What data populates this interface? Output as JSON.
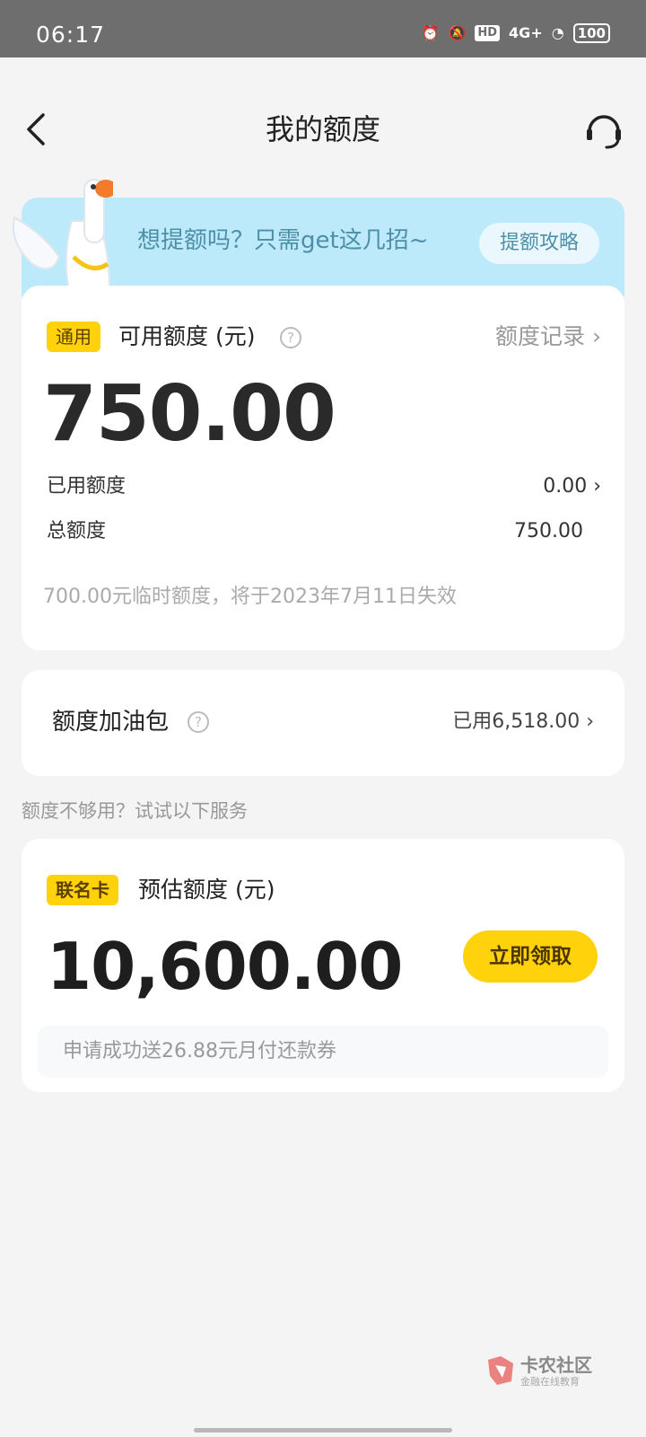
{
  "status_bar": {
    "time": "06:17",
    "network": "4G+",
    "battery": "100",
    "hd_label": "HD"
  },
  "header": {
    "title": "我的额度"
  },
  "promo": {
    "text": "想提额吗？只需get这几招~",
    "button_label": "提额攻略"
  },
  "quota": {
    "tag": "通用",
    "label": "可用额度 (元)",
    "record_link": "额度记录 ›",
    "available": "750.00",
    "used_label": "已用额度",
    "used_value": "0.00 ›",
    "total_label": "总额度",
    "total_value": "750.00",
    "temp_note": "700.00元临时额度，将于2023年7月11日失效"
  },
  "boost": {
    "title": "额度加油包",
    "value": "已用6,518.00 ›"
  },
  "hint": "额度不够用？试试以下服务",
  "cobrand": {
    "tag": "联名卡",
    "label": "预估额度 (元)",
    "amount": "10,600.00",
    "button_label": "立即领取",
    "coupon_text": "申请成功送26.88元月付还款券"
  },
  "watermark": {
    "title": "卡农社区",
    "subtitle": "金融在线教育"
  },
  "colors": {
    "accent": "#ffd20c",
    "banner": "#bdeafb",
    "status_bar": "#6e6e6e"
  },
  "icons": {
    "back": "chevron-left-icon",
    "service": "headset-icon",
    "help": "question-circle-icon"
  }
}
